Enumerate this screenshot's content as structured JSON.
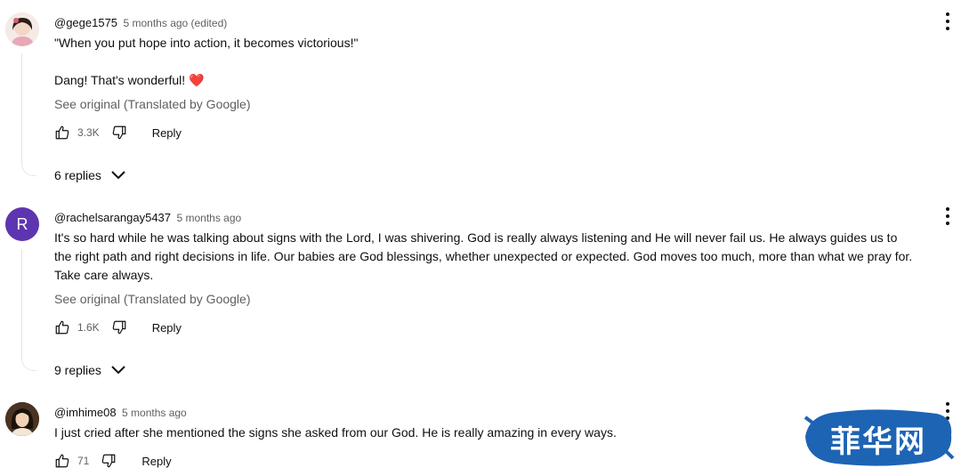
{
  "comments": [
    {
      "author": "@gege1575",
      "time": "5 months ago (edited)",
      "lines": [
        "\"When you put hope into action, it becomes victorious!\"",
        "",
        "Dang! That's wonderful! ❤️"
      ],
      "translate": "See original (Translated by Google)",
      "likes": "3.3K",
      "reply": "Reply",
      "replies": "6 replies"
    },
    {
      "author": "@rachelsarangay5437",
      "avatar_letter": "R",
      "time": "5 months ago",
      "lines": [
        "It's so hard while he was talking about signs with the Lord, I was shivering. God is really always listening and He will never fail us. He always guides us to",
        "the right path and right decisions in life. Our babies are God blessings, whether unexpected or expected. God moves too much, more than what we pray for.",
        "Take care always."
      ],
      "translate": "See original (Translated by Google)",
      "likes": "1.6K",
      "reply": "Reply",
      "replies": "9 replies"
    },
    {
      "author": "@imhime08",
      "time": "5 months ago",
      "lines": [
        "I just cried after she mentioned the signs she asked from our God. He is really amazing in every ways."
      ],
      "likes": "71",
      "reply": "Reply"
    }
  ],
  "icons": {
    "like": "thumb-up-icon",
    "dislike": "thumb-down-icon",
    "expand": "chevron-down-icon",
    "menu": "more-vert-icon"
  },
  "colors": {
    "avatar_r": "#5e35b1",
    "heart": "#e53935",
    "watermark": "#1e64b4"
  },
  "watermark": {
    "text": "菲华网"
  }
}
